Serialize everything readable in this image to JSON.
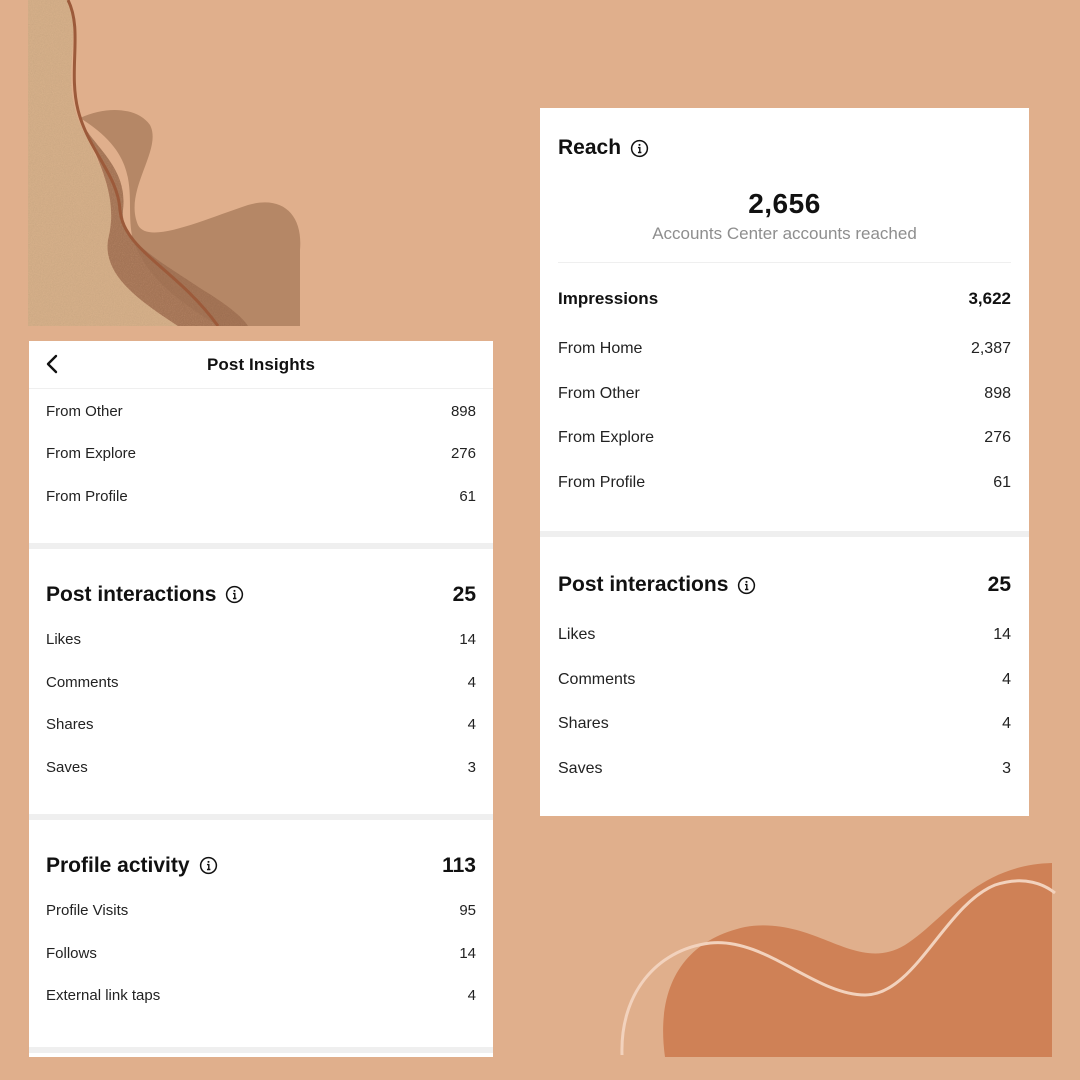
{
  "left_panel": {
    "header_title": "Post Insights",
    "impressions_sources": [
      {
        "label": "From Other",
        "value": "898"
      },
      {
        "label": "From Explore",
        "value": "276"
      },
      {
        "label": "From Profile",
        "value": "61"
      }
    ],
    "post_interactions": {
      "title": "Post interactions",
      "total": "25",
      "items": [
        {
          "label": "Likes",
          "value": "14"
        },
        {
          "label": "Comments",
          "value": "4"
        },
        {
          "label": "Shares",
          "value": "4"
        },
        {
          "label": "Saves",
          "value": "3"
        }
      ]
    },
    "profile_activity": {
      "title": "Profile activity",
      "total": "113",
      "items": [
        {
          "label": "Profile Visits",
          "value": "95"
        },
        {
          "label": "Follows",
          "value": "14"
        },
        {
          "label": "External link taps",
          "value": "4"
        }
      ]
    }
  },
  "right_panel": {
    "reach_title": "Reach",
    "reach_value": "2,656",
    "reach_caption": "Accounts Center accounts reached",
    "impressions_label": "Impressions",
    "impressions_total": "3,622",
    "impressions_sources": [
      {
        "label": "From Home",
        "value": "2,387"
      },
      {
        "label": "From Other",
        "value": "898"
      },
      {
        "label": "From Explore",
        "value": "276"
      },
      {
        "label": "From Profile",
        "value": "61"
      }
    ],
    "post_interactions": {
      "title": "Post interactions",
      "total": "25",
      "items": [
        {
          "label": "Likes",
          "value": "14"
        },
        {
          "label": "Comments",
          "value": "4"
        },
        {
          "label": "Shares",
          "value": "4"
        },
        {
          "label": "Saves",
          "value": "3"
        }
      ]
    }
  },
  "icons": {
    "back": "chevron-left-icon",
    "info": "info-circle-icon"
  },
  "colors": {
    "background": "#e0af8c",
    "card": "#ffffff",
    "separator": "#efefef",
    "muted_text": "#8e8e8e",
    "decor_dark": "#b88a68",
    "decor_accent": "#cf8156"
  }
}
